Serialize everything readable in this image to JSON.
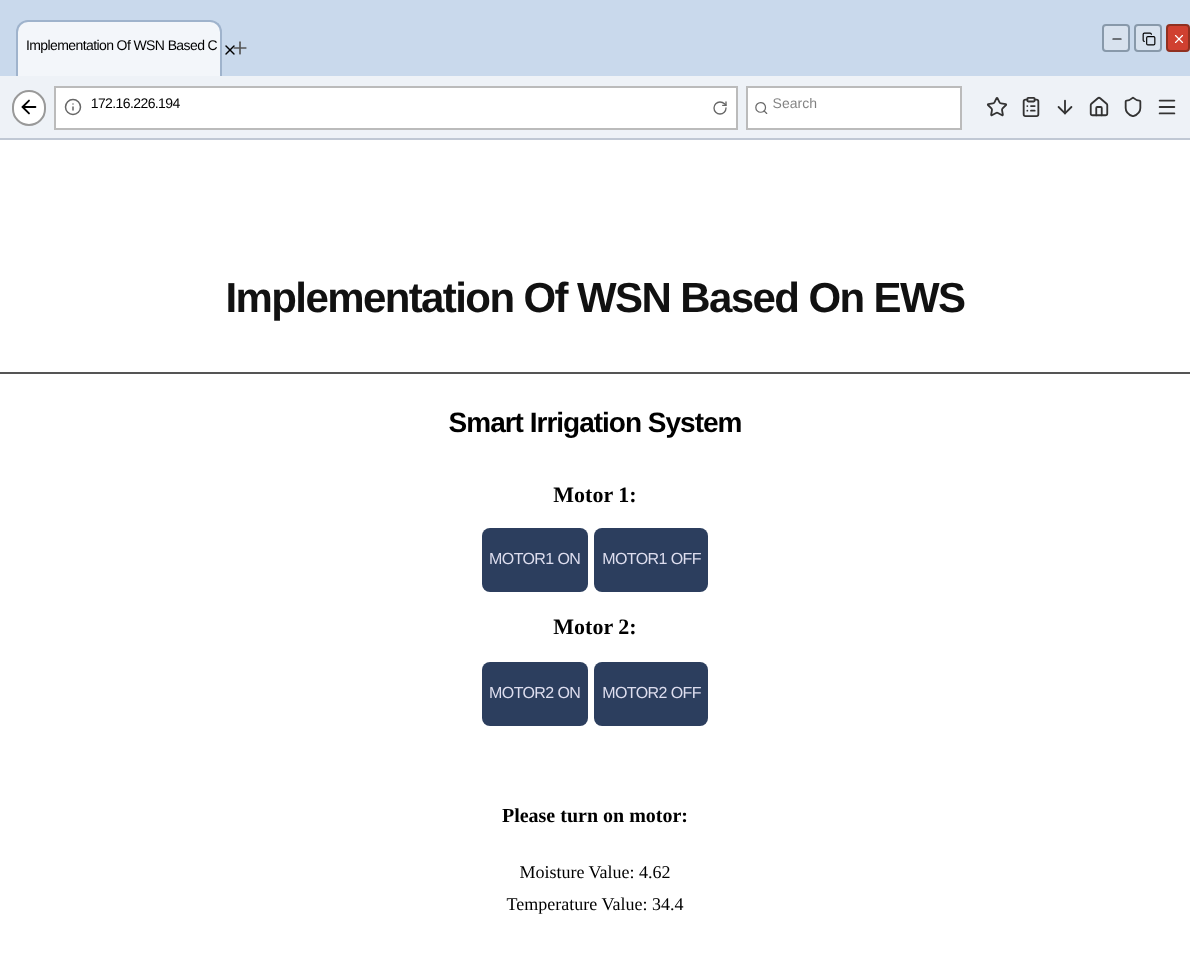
{
  "browser": {
    "tab_title": "Implementation Of WSN Based C",
    "url": "172.16.226.194",
    "search_placeholder": "Search"
  },
  "page": {
    "title": "Implementation Of WSN Based On EWS",
    "subtitle": "Smart Irrigation System",
    "motors": [
      {
        "label": "Motor 1:",
        "buttons": [
          "MOTOR1 ON",
          "MOTOR1 OFF"
        ]
      },
      {
        "label": "Motor 2:",
        "buttons": [
          "MOTOR2 ON",
          "MOTOR2 OFF"
        ]
      }
    ],
    "message": "Please turn on motor:",
    "readings": [
      "Moisture Value: 4.62",
      "Temperature Value: 34.4"
    ]
  }
}
